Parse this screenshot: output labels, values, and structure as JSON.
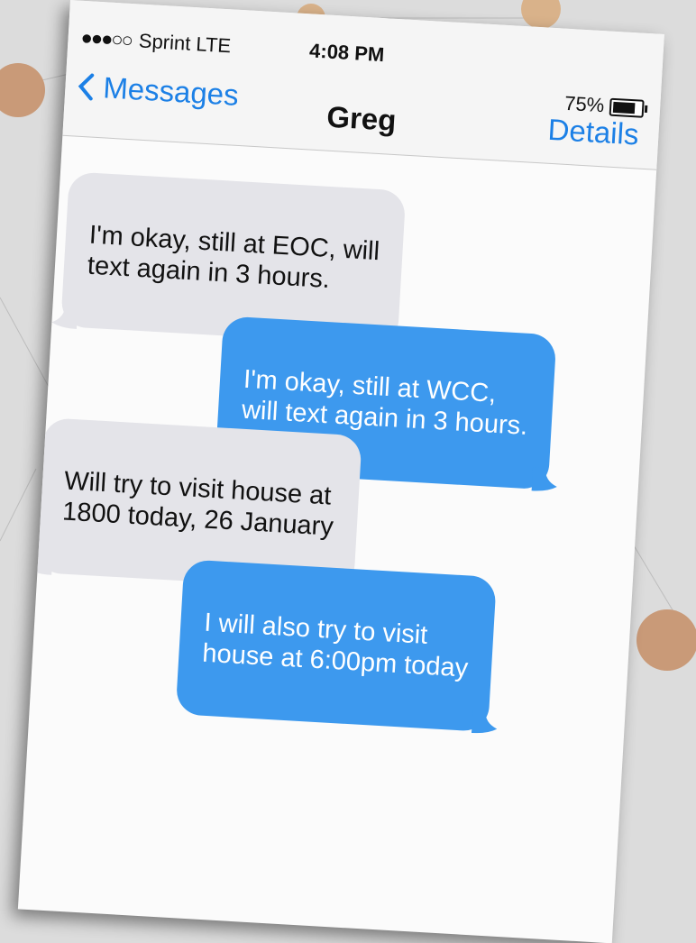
{
  "status_bar": {
    "signal": "●●●○○",
    "carrier": "Sprint  LTE",
    "time": "4:08 PM",
    "battery_percent": "75%",
    "battery_level": 0.75
  },
  "nav": {
    "back_label": "Messages",
    "contact_name": "Greg",
    "details_label": "Details"
  },
  "messages": [
    {
      "direction": "incoming",
      "text": "I'm okay, still at EOC, will\ntext again in 3 hours."
    },
    {
      "direction": "outgoing",
      "text": "I'm okay, still at WCC,\nwill text again in 3 hours."
    },
    {
      "direction": "incoming",
      "text": "Will try to visit house at\n1800 today, 26 January"
    },
    {
      "direction": "outgoing",
      "text": "I will also try to visit\nhouse at 6:00pm today"
    }
  ],
  "colors": {
    "accent": "#1c80e6",
    "outgoing_bubble": "#3d99ee",
    "incoming_bubble": "#e4e4e9",
    "background": "#dcdcdc"
  }
}
